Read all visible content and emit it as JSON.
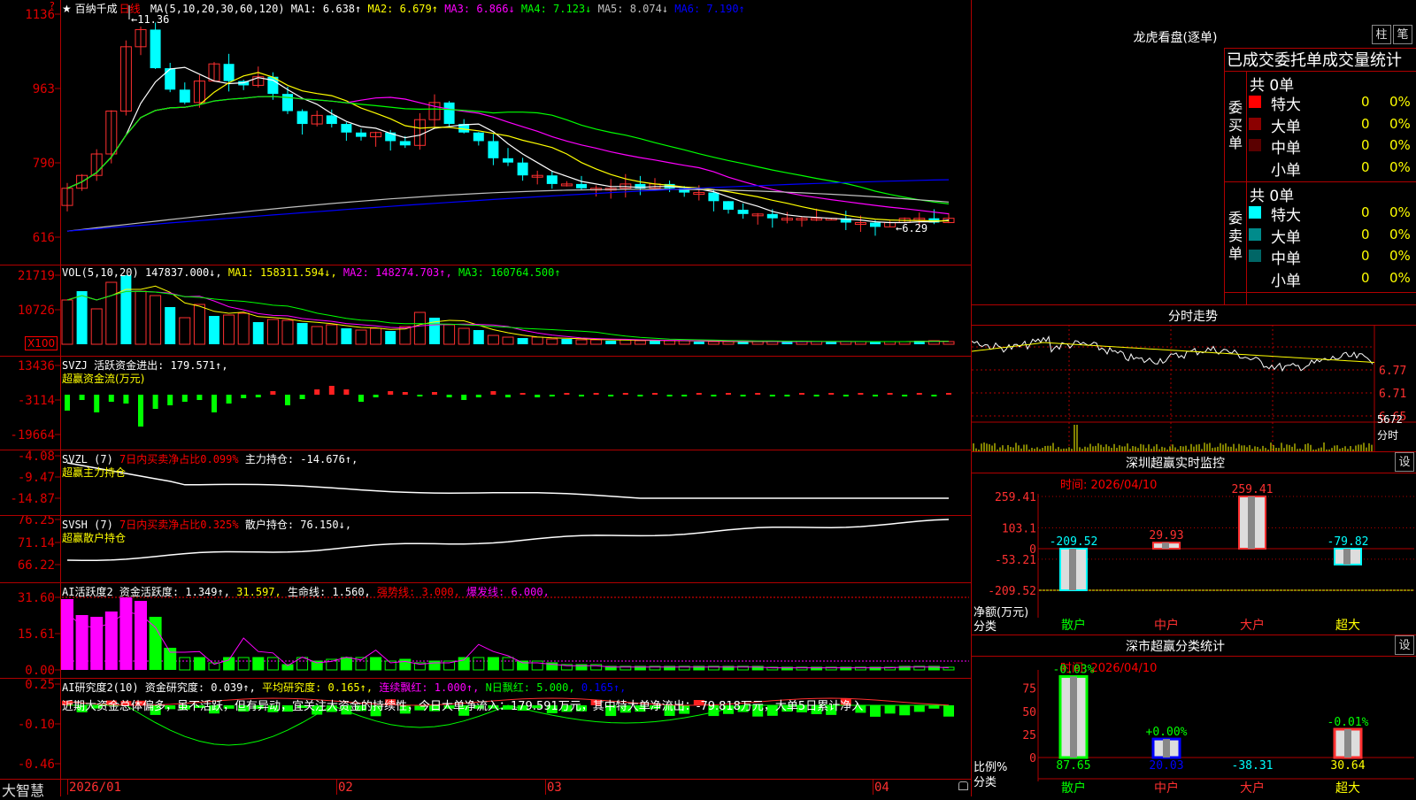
{
  "app": {
    "logo": "大智慧"
  },
  "kline": {
    "title": "★ 百纳千成",
    "period": "日线",
    "ma_header": "MA(5,10,20,30,60,120)",
    "ma_items": [
      {
        "label": "MA1: 6.638↑",
        "color": "#ffffff"
      },
      {
        "label": "MA2: 6.679↑",
        "color": "#ffff00"
      },
      {
        "label": "MA3: 6.866↓",
        "color": "#ff00ff"
      },
      {
        "label": "MA4: 7.123↓",
        "color": "#00ff00"
      },
      {
        "label": "MA5: 8.074↓",
        "color": "#c0c0c0"
      },
      {
        "label": "MA6: 7.190↑",
        "color": "#0000ff"
      }
    ],
    "yticks": [
      "1136",
      "963",
      "790",
      "616"
    ],
    "high_note": "11.36",
    "low_note": "6.29"
  },
  "vol": {
    "header": "VOL(5,10,20)",
    "items": [
      {
        "label": "147837.000↓,",
        "color": "#ffffff"
      },
      {
        "label": "MA1: 158311.594↓,",
        "color": "#ffff00"
      },
      {
        "label": "MA2: 148274.703↑,",
        "color": "#ff00ff"
      },
      {
        "label": "MA3: 160764.500↑",
        "color": "#00ff00"
      }
    ],
    "yticks": [
      "21719",
      "10726"
    ],
    "unit": "X100"
  },
  "svzj": {
    "header": "SVZJ  活跃资金进出: 179.571↑,",
    "sub": "超赢资金流(万元)",
    "yticks": [
      "13436",
      "-3114",
      "-19664"
    ]
  },
  "svzl": {
    "header": "SVZL (7)",
    "item1": "7日内买卖净占比0.099%",
    "item2": "主力持仓: -14.676↑,",
    "sub": "超赢主力持仓",
    "yticks": [
      "-4.08",
      "-9.47",
      "-14.87"
    ]
  },
  "svsh": {
    "header": "SVSH (7)",
    "item1": "7日内买卖净占比0.325%",
    "item2": "散户持仓: 76.150↓,",
    "sub": "超赢散户持仓",
    "yticks": [
      "76.25",
      "71.14",
      "66.22"
    ]
  },
  "ai1": {
    "header": "AI活跃度2",
    "items": [
      {
        "label": "资金活跃度: 1.349↑,",
        "color": "#ffffff"
      },
      {
        "label": "31.597,",
        "color": "#ffff00"
      },
      {
        "label": "生命线: 1.560,",
        "color": "#ffffff"
      },
      {
        "label": "强势线: 3.000,",
        "color": "#ff0000"
      },
      {
        "label": "爆发线: 6.000,",
        "color": "#ff00ff"
      }
    ],
    "yticks": [
      "31.60",
      "15.61",
      "0.00"
    ]
  },
  "ai2": {
    "header": "AI研究度2(10)",
    "items": [
      {
        "label": "资金研究度: 0.039↑,",
        "color": "#ffffff"
      },
      {
        "label": "平均研究度: 0.165↑,",
        "color": "#ffff00"
      },
      {
        "label": "连续飘红: 1.000↑,",
        "color": "#ff00ff"
      },
      {
        "label": "N日飘红: 5.000,",
        "color": "#00ff00"
      },
      {
        "label": "0.165↑,",
        "color": "#0000ff"
      }
    ],
    "comment": "近期大资金总体偏多，虽不活跃，但有异动，宜关注大资金的持续性，今日大单净流入：179.591万元，其中特大单净流出：-79.818万元，大单5日累计净入",
    "yticks": [
      "0.25",
      "-0.10",
      "-0.46"
    ]
  },
  "xaxis": {
    "labels": [
      "2026/01",
      "02",
      "03",
      "04"
    ]
  },
  "longhu": {
    "title": "龙虎看盘(逐单)",
    "btn1": "柱",
    "btn2": "笔",
    "tabs": "已成交委托单成交量统计",
    "buy": {
      "side_label": "委买单",
      "total": "共 0单",
      "rows": [
        {
          "name": "特大",
          "count": "0",
          "pct": "0%",
          "color": "#ff0000"
        },
        {
          "name": "大单",
          "count": "0",
          "pct": "0%",
          "color": "#8b0000"
        },
        {
          "name": "中单",
          "count": "0",
          "pct": "0%",
          "color": "#5a0000"
        },
        {
          "name": "小单",
          "count": "0",
          "pct": "0%",
          "color": ""
        }
      ]
    },
    "sell": {
      "side_label": "委卖单",
      "total": "共 0单",
      "rows": [
        {
          "name": "特大",
          "count": "0",
          "pct": "0%",
          "color": "#00ffff"
        },
        {
          "name": "大单",
          "count": "0",
          "pct": "0%",
          "color": "#008b8b"
        },
        {
          "name": "中单",
          "count": "0",
          "pct": "0%",
          "color": "#006666"
        },
        {
          "name": "小单",
          "count": "0",
          "pct": "0%",
          "color": ""
        }
      ]
    }
  },
  "intraday": {
    "title": "分时走势",
    "yticks": [
      "6.77",
      "6.71",
      "6.65"
    ],
    "vol_top": "5672",
    "vol_unit": "分时"
  },
  "sz_monitor": {
    "title": "深圳超赢实时监控",
    "settings": "设",
    "time": "时间: 2026/04/10",
    "yticks": [
      "259.41",
      "103.1",
      "0",
      "-53.21",
      "-209.52"
    ],
    "ylabel": "净额(万元)",
    "xlabel": "分类",
    "chart_data": {
      "type": "bar",
      "categories": [
        "散户",
        "中户",
        "大户",
        "超大"
      ],
      "values": [
        -209.52,
        29.93,
        259.41,
        -79.82
      ],
      "ylim": [
        -209.52,
        259.41
      ]
    }
  },
  "sz_stats": {
    "title": "深市超赢分类统计",
    "settings": "设",
    "time": "时间: 2026/04/10",
    "yticks": [
      "75",
      "50",
      "25",
      "0"
    ],
    "ylabel": "比例%",
    "xlabel": "分类",
    "top_labels": [
      "-0.03%",
      "+0.00%",
      "",
      "-0.01%"
    ],
    "chart_data": {
      "type": "bar",
      "categories": [
        "散户",
        "中户",
        "大户",
        "超大"
      ],
      "values": [
        87.65,
        20.03,
        -38.31,
        30.64
      ],
      "ylim": [
        0,
        90
      ]
    }
  }
}
